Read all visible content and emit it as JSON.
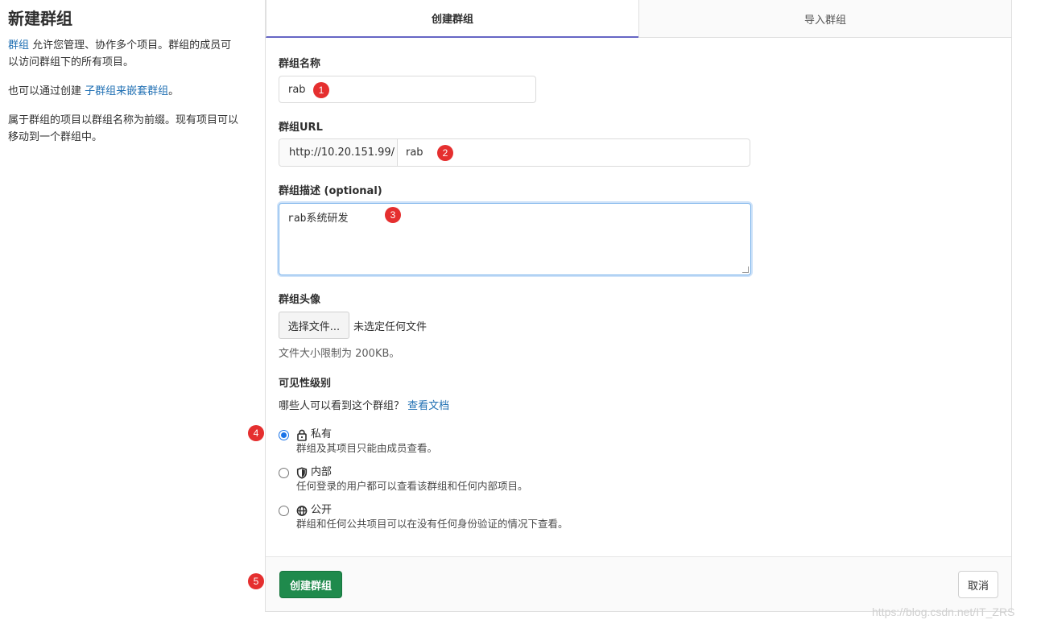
{
  "left": {
    "title": "新建群组",
    "p1_link": "群组",
    "p1_text": " 允许您管理、协作多个项目。群组的成员可以访问群组下的所有项目。",
    "p2_text": "也可以通过创建 ",
    "p2_link": "子群组来嵌套群组",
    "p2_end": "。",
    "p3_text": "属于群组的项目以群组名称为前缀。现有项目可以移动到一个群组中。"
  },
  "tabs": [
    {
      "label": "创建群组",
      "active": true
    },
    {
      "label": "导入群组",
      "active": false
    }
  ],
  "form": {
    "name_label": "群组名称",
    "name_value": "rab",
    "url_label": "群组URL",
    "url_prefix": "http://10.20.151.99/",
    "url_path": "rab",
    "desc_label": "群组描述 (optional)",
    "desc_value": "rab系统研发",
    "avatar_label": "群组头像",
    "file_button": "选择文件...",
    "file_status": "未选定任何文件",
    "file_help": "文件大小限制为 200KB。",
    "visibility_label": "可见性级别",
    "visibility_help": "哪些人可以看到这个群组？",
    "visibility_link": "查看文档",
    "options": [
      {
        "title": "私有",
        "desc": "群组及其项目只能由成员查看。",
        "icon": "lock-icon",
        "checked": true
      },
      {
        "title": "内部",
        "desc": "任何登录的用户都可以查看该群组和任何内部项目。",
        "icon": "shield-icon",
        "checked": false
      },
      {
        "title": "公开",
        "desc": "群组和任何公共项目可以在没有任何身份验证的情况下查看。",
        "icon": "globe-icon",
        "checked": false
      }
    ]
  },
  "footer": {
    "submit": "创建群组",
    "cancel": "取消"
  },
  "badges": [
    "1",
    "2",
    "3",
    "4",
    "5"
  ],
  "watermark": "https://blog.csdn.net/IT_ZRS",
  "colors": {
    "primary_green": "#1f8a4c",
    "link_blue": "#1f6fb3",
    "tab_underline": "#6666c4",
    "badge_red": "#e52f2f"
  }
}
